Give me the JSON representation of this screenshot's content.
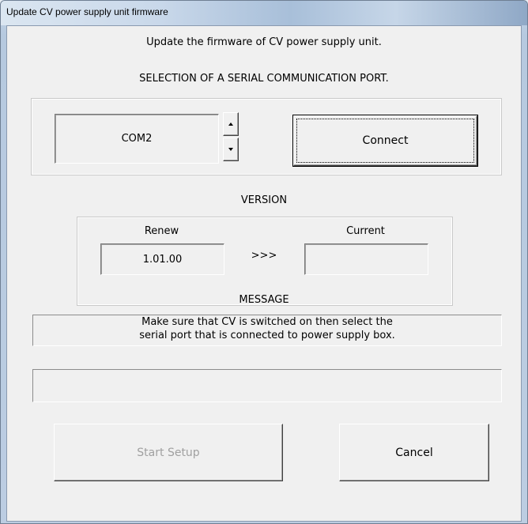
{
  "window": {
    "title": "Update CV power supply unit firmware"
  },
  "header": {
    "intro": "Update the firmware of CV power supply unit.",
    "port_heading": "SELECTION OF A SERIAL COMMUNICATION PORT."
  },
  "port": {
    "value": "COM2",
    "connect_label": "Connect"
  },
  "version": {
    "heading": "VERSION",
    "renew_label": "Renew",
    "current_label": "Current",
    "renew_value": "1.01.00",
    "arrow_text": ">>>",
    "current_value": ""
  },
  "message": {
    "heading": "MESSAGE",
    "line1": "Make sure that CV is switched on then select the",
    "line2": "serial port that is connected to power supply box.",
    "progress_text": ""
  },
  "buttons": {
    "start_label": "Start Setup",
    "cancel_label": "Cancel"
  },
  "icons": {
    "spin_up": "spin-up-icon",
    "spin_down": "spin-down-icon"
  }
}
